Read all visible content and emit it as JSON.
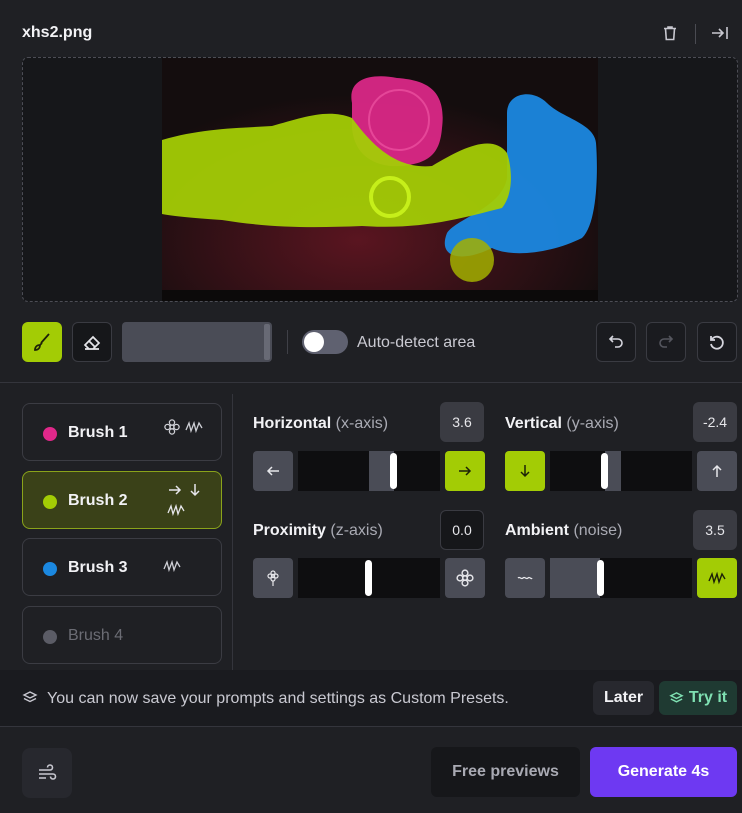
{
  "header": {
    "filename": "xhs2.png",
    "delete_icon": "trash-icon",
    "collapse_icon": "collapse-right-icon"
  },
  "canvas": {
    "mask_colors": {
      "brush1": "#e0288a",
      "brush2": "#a3cc05",
      "brush3": "#1b88e0"
    }
  },
  "toolbar": {
    "brush_icon": "paintbrush-icon",
    "eraser_icon": "eraser-icon",
    "auto_detect_label": "Auto-detect area",
    "auto_detect_on": false,
    "undo_icon": "undo-icon",
    "redo_icon": "redo-icon",
    "reset_icon": "reset-icon"
  },
  "brushes": [
    {
      "name": "Brush 1",
      "color": "#e0288a",
      "icons": "proximity, ambient",
      "state": "normal"
    },
    {
      "name": "Brush 2",
      "color": "#a3cc05",
      "icons": "horizontal, vertical, ambient",
      "state": "active"
    },
    {
      "name": "Brush 3",
      "color": "#1b88e0",
      "icons": "ambient",
      "state": "normal"
    },
    {
      "name": "Brush 4",
      "color": "#5b5c66",
      "icons": "",
      "state": "disabled"
    }
  ],
  "params": {
    "horizontal": {
      "label": "Horizontal",
      "axis": "(x-axis)",
      "value": "3.6"
    },
    "vertical": {
      "label": "Vertical",
      "axis": "(y-axis)",
      "value": "-2.4"
    },
    "proximity": {
      "label": "Proximity",
      "axis": "(z-axis)",
      "value": "0.0"
    },
    "ambient": {
      "label": "Ambient",
      "axis": "(noise)",
      "value": "3.5"
    }
  },
  "banner": {
    "text": "You can now save your prompts and settings as Custom Presets.",
    "later_label": "Later",
    "try_label": "Try it"
  },
  "footer": {
    "free_previews_label": "Free previews",
    "generate_label": "Generate 4s"
  },
  "colors": {
    "accent_green": "#a3cc05",
    "generate_purple": "#6e39f2",
    "panel_bg": "#1f2024"
  }
}
